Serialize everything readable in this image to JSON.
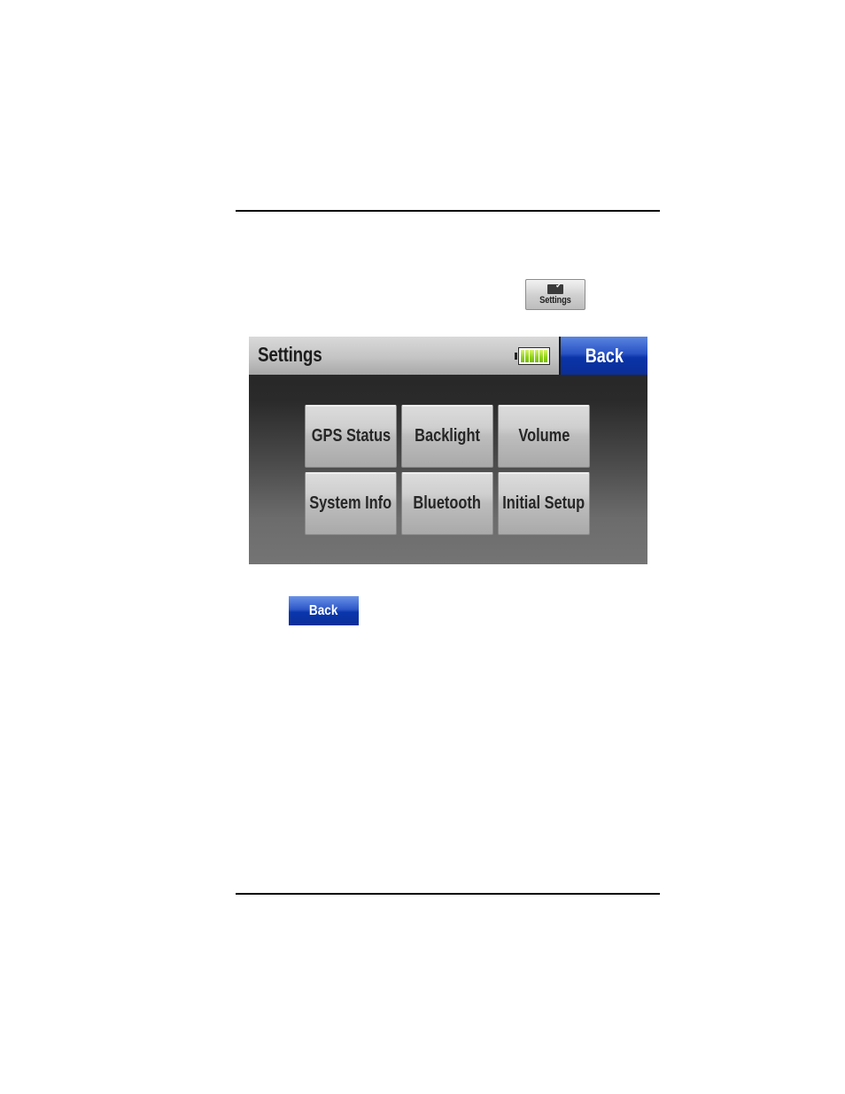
{
  "inline_icons": {
    "settings_button": {
      "label": "Settings",
      "icon": "folder-check-icon"
    },
    "back_button": {
      "label": "Back"
    }
  },
  "screen": {
    "title": "Settings",
    "battery": {
      "level": 1.0,
      "segments": 6,
      "color": "#8fd21a"
    },
    "back_label": "Back",
    "back_color": "#0a34a8",
    "menu": [
      {
        "label": "GPS Status"
      },
      {
        "label": "Backlight"
      },
      {
        "label": "Volume"
      },
      {
        "label": "System Info"
      },
      {
        "label": "Bluetooth"
      },
      {
        "label": "Initial Setup"
      }
    ]
  }
}
